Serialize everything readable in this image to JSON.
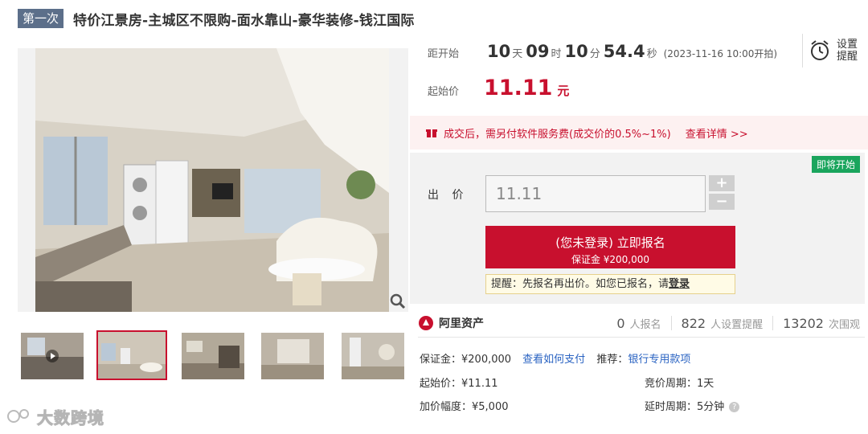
{
  "header": {
    "round_badge": "第一次",
    "title": "特价江景房-主城区不限购-面水靠山-豪华装修-钱江国际"
  },
  "countdown": {
    "label": "距开始",
    "days": "10",
    "days_unit": "天",
    "hours": "09",
    "hours_unit": "时",
    "minutes": "10",
    "minutes_unit": "分",
    "seconds": "54.4",
    "seconds_unit": "秒",
    "start_time": "(2023-11-16 10:00开拍)"
  },
  "reminder": {
    "label": "设置提醒",
    "icon": "alarm-clock-icon"
  },
  "start_price": {
    "label": "起始价",
    "value": "11.11",
    "unit": "元"
  },
  "fee_notice": {
    "icon": "gift-icon",
    "text": "成交后，需另付软件服务费(成交价的0.5%~1%)",
    "link": "查看详情 >>"
  },
  "bid_panel": {
    "status_badge": "即将开始",
    "bid_label": "出 价",
    "bid_value": "11.11",
    "plus": "+",
    "minus": "−",
    "signup_main": "(您未登录) 立即报名",
    "signup_sub": "保证金 ¥200,000",
    "tip_text": "提醒：先报名再出价。如您已报名，请",
    "tip_link": "登录"
  },
  "platform": {
    "name": "阿里资产",
    "signup_count": "0",
    "signup_label": "人报名",
    "reminder_count": "822",
    "reminder_label": "人设置提醒",
    "view_count": "13202",
    "view_label": "次围观"
  },
  "details": {
    "deposit": "保证金：¥200,000",
    "how_to_pay": "查看如何支付",
    "recommend_label": "推荐：",
    "recommend_link": "银行专用款项",
    "start_price": "起始价：¥11.11",
    "bid_period": "竞价周期：1天",
    "increment": "加价幅度：¥5,000",
    "extension": "延时周期：5分钟"
  },
  "watermark": {
    "text": "大数跨境"
  },
  "colors": {
    "accent": "#c8102e",
    "link": "#2a63c2",
    "badge_green": "#1aa55d",
    "round_badge": "#5c6f8a"
  }
}
